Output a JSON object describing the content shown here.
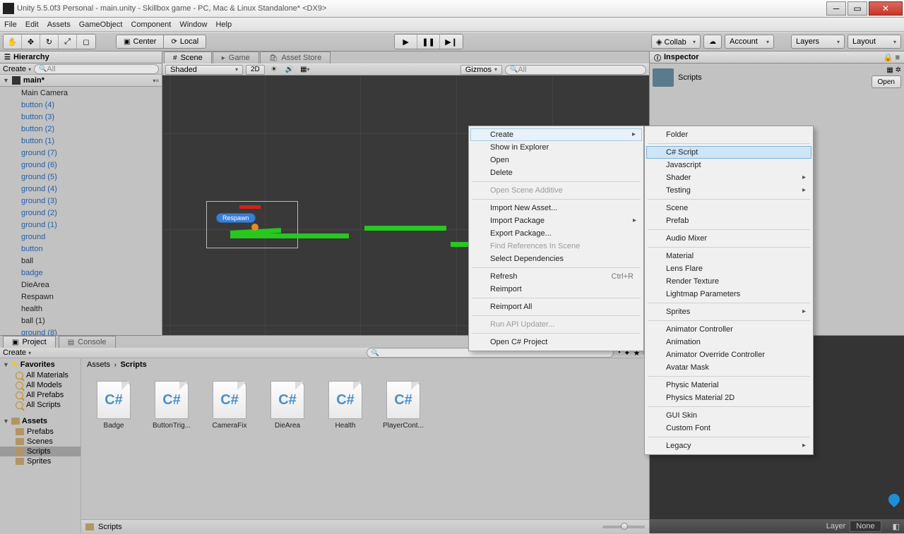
{
  "title": "Unity 5.5.0f3 Personal - main.unity - Skillbox game - PC, Mac & Linux Standalone* <DX9>",
  "menu": [
    "File",
    "Edit",
    "Assets",
    "GameObject",
    "Component",
    "Window",
    "Help"
  ],
  "toolbar": {
    "center": "Center",
    "local": "Local",
    "collab": "Collab",
    "account": "Account",
    "layers": "Layers",
    "layout": "Layout"
  },
  "hierarchy": {
    "tab": "Hierarchy",
    "create": "Create",
    "searchPH": "All",
    "scene": "main*",
    "items": [
      {
        "t": "Main Camera",
        "c": "black"
      },
      {
        "t": "button (4)"
      },
      {
        "t": "button (3)"
      },
      {
        "t": "button (2)"
      },
      {
        "t": "button (1)"
      },
      {
        "t": "ground (7)"
      },
      {
        "t": "ground (6)"
      },
      {
        "t": "ground (5)"
      },
      {
        "t": "ground (4)"
      },
      {
        "t": "ground (3)"
      },
      {
        "t": "ground (2)"
      },
      {
        "t": "ground (1)"
      },
      {
        "t": "ground"
      },
      {
        "t": "button"
      },
      {
        "t": "ball",
        "c": "black"
      },
      {
        "t": "badge"
      },
      {
        "t": "DieArea",
        "c": "black"
      },
      {
        "t": "Respawn",
        "c": "black"
      },
      {
        "t": "health",
        "c": "black"
      },
      {
        "t": "ball (1)",
        "c": "black"
      },
      {
        "t": "ground (8)"
      }
    ]
  },
  "scene": {
    "tabs": [
      "Scene",
      "Game",
      "Asset Store"
    ],
    "shaded": "Shaded",
    "mode2d": "2D",
    "gizmos": "Gizmos",
    "searchPH": "All",
    "respawn": "Respawn"
  },
  "inspector": {
    "tab": "Inspector",
    "title": "Scripts",
    "open": "Open"
  },
  "project": {
    "tab": "Project",
    "console": "Console",
    "create": "Create",
    "favorites": "Favorites",
    "favItems": [
      "All Materials",
      "All Models",
      "All Prefabs",
      "All Scripts"
    ],
    "assets": "Assets",
    "assetItems": [
      "Prefabs",
      "Scenes",
      "Scripts",
      "Sprites"
    ],
    "breadcrumb": [
      "Assets",
      "Scripts"
    ],
    "scripts": [
      "Badge",
      "ButtonTrig...",
      "CameraFix",
      "DieArea",
      "Health",
      "PlayerCont..."
    ],
    "footer": "Scripts",
    "layer": "Layer",
    "none": "None"
  },
  "ctx1": [
    {
      "t": "Create",
      "k": "arrow hl-main"
    },
    {
      "t": "Show in Explorer"
    },
    {
      "t": "Open"
    },
    {
      "t": "Delete"
    },
    {
      "t": "",
      "k": "sep"
    },
    {
      "t": "Open Scene Additive",
      "k": "disabled"
    },
    {
      "t": "",
      "k": "sep"
    },
    {
      "t": "Import New Asset..."
    },
    {
      "t": "Import Package",
      "k": "arrow"
    },
    {
      "t": "Export Package..."
    },
    {
      "t": "Find References In Scene",
      "k": "disabled"
    },
    {
      "t": "Select Dependencies"
    },
    {
      "t": "",
      "k": "sep"
    },
    {
      "t": "Refresh",
      "s": "Ctrl+R"
    },
    {
      "t": "Reimport"
    },
    {
      "t": "",
      "k": "sep"
    },
    {
      "t": "Reimport All"
    },
    {
      "t": "",
      "k": "sep"
    },
    {
      "t": "Run API Updater...",
      "k": "disabled"
    },
    {
      "t": "",
      "k": "sep"
    },
    {
      "t": "Open C# Project"
    }
  ],
  "ctx2": [
    {
      "t": "Folder"
    },
    {
      "t": "",
      "k": "sep"
    },
    {
      "t": "C# Script",
      "k": "hl"
    },
    {
      "t": "Javascript"
    },
    {
      "t": "Shader",
      "k": "arrow"
    },
    {
      "t": "Testing",
      "k": "arrow"
    },
    {
      "t": "",
      "k": "sep"
    },
    {
      "t": "Scene"
    },
    {
      "t": "Prefab"
    },
    {
      "t": "",
      "k": "sep"
    },
    {
      "t": "Audio Mixer"
    },
    {
      "t": "",
      "k": "sep"
    },
    {
      "t": "Material"
    },
    {
      "t": "Lens Flare"
    },
    {
      "t": "Render Texture"
    },
    {
      "t": "Lightmap Parameters"
    },
    {
      "t": "",
      "k": "sep"
    },
    {
      "t": "Sprites",
      "k": "arrow"
    },
    {
      "t": "",
      "k": "sep"
    },
    {
      "t": "Animator Controller"
    },
    {
      "t": "Animation"
    },
    {
      "t": "Animator Override Controller"
    },
    {
      "t": "Avatar Mask"
    },
    {
      "t": "",
      "k": "sep"
    },
    {
      "t": "Physic Material"
    },
    {
      "t": "Physics Material 2D"
    },
    {
      "t": "",
      "k": "sep"
    },
    {
      "t": "GUI Skin"
    },
    {
      "t": "Custom Font"
    },
    {
      "t": "",
      "k": "sep"
    },
    {
      "t": "Legacy",
      "k": "arrow"
    }
  ]
}
